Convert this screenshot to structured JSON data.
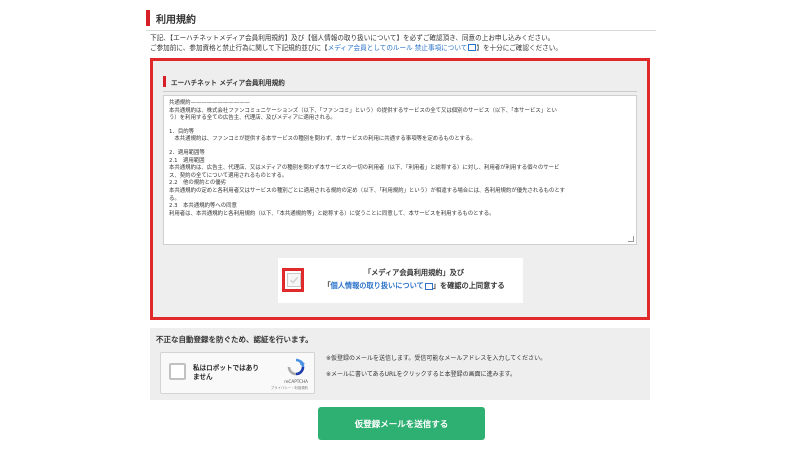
{
  "section": {
    "title": "利用規約"
  },
  "intro": {
    "line1": "下記、【エーハチネットメディア会員利用規約】及び【個人情報の取り扱いについて】を必ずご確認頂き、同意の上お申し込みください。",
    "line2_prefix": "ご参加前に、参加資格と禁止行為に関して下記規約並びに【",
    "line2_link": "メディア会員としてのルール 禁止事項について",
    "line2_suffix": "】を十分にご確認ください。"
  },
  "terms": {
    "heading": "エーハチネット メディア会員利用規約",
    "lines": [
      "共通規約———————————",
      "本共通規約は、株式会社ファンコミュニケーションズ（以下、「ファンコミ」という）の提供するサービスの全て又は個別のサービス（以下、「本サービス」とい",
      "う）を利用する全ての広告主、代理店、及びメディアに適用される。",
      "",
      "1．目的等",
      "　本共通規約は、ファンコミが提供する本サービスの種別を問わず、本サービスの利用に共通する事項等を定めるものとする。",
      "",
      "2．適用範囲等",
      "2.1　適用範囲",
      "本共通規約は、広告主、代理店、又はメディアの種別を問わず本サービスの一切の利用者（以下、「利用者」と総称する）に対し、利用者が利用する個々のサービ",
      "ス、契約の全てについて適用されるものとする。",
      "2.2　他の規約との優劣",
      "本共通規約の定めと各利用者又はサービスの種別ごとに適用される規約の定め（以下、「利用規約」という）が相違する場合には、各利用規約が優先されるものとす",
      "る。",
      "2.3　本共通規約等への同意",
      "利用者は、本共通規約と各利用規約（以下、「本共通規約等」と総称する）に従うことに同意して、本サービスを利用するものとする。"
    ]
  },
  "agree": {
    "line1": "「メディア会員利用規約」及び",
    "line2_open": "「",
    "line2_link": "個人情報の取り扱いについて",
    "line2_suffix": "」を確認の上同意する"
  },
  "robot": {
    "title": "不正な自動登録を防ぐため、認証を行います。",
    "recaptcha_label_1": "私はロボットではあり",
    "recaptcha_label_2": "ません",
    "recaptcha_brand": "reCAPTCHA",
    "recaptcha_links": "プライバシー・利用規約",
    "note1": "※仮登録のメールを送信します。受信可能なメールアドレスを入力してください。",
    "note2": "※メールに書いてあるURLをクリックすると本登録の画面に進みます。"
  },
  "submit": {
    "label": "仮登録メールを送信する"
  },
  "colors": {
    "accent_red": "#e0292b",
    "submit_green": "#2fb073",
    "link_blue": "#2a73c9"
  }
}
